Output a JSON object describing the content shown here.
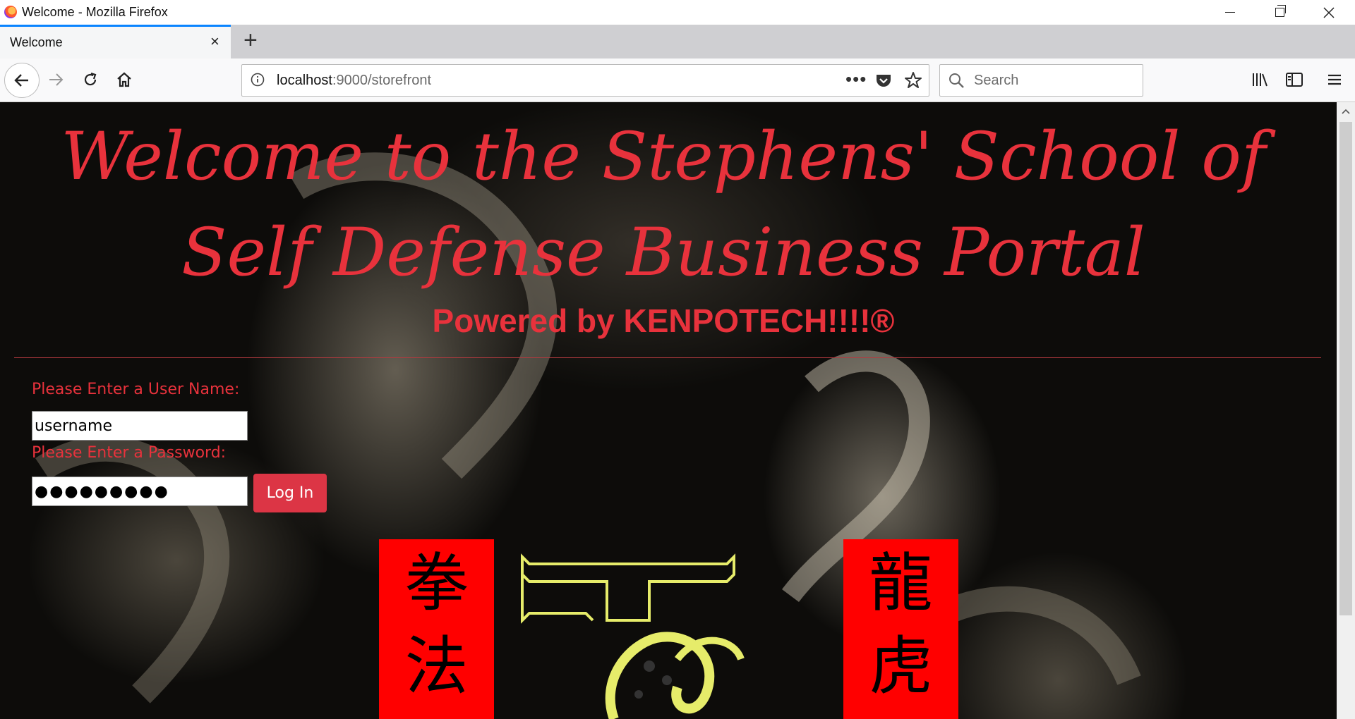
{
  "window": {
    "title": "Welcome - Mozilla Firefox"
  },
  "tabs": [
    {
      "label": "Welcome",
      "active": true
    }
  ],
  "navbar": {
    "url_host": "localhost",
    "url_rest": ":9000/storefront",
    "search_placeholder": "Search"
  },
  "page": {
    "heading": "Welcome to the Stephens' School of Self Defense Business Portal",
    "powered_by": "Powered by KENPOTECH!!!!®",
    "login": {
      "username_label": "Please Enter a User Name:",
      "username_value": "username",
      "password_label": "Please Enter a Password:",
      "password_value": "●●●●●●●●●",
      "button_label": "Log In"
    },
    "banner_left": "拳法",
    "banner_right": "龍虎"
  },
  "colors": {
    "accent_red": "#e8323c",
    "button_red": "#dc3545",
    "banner_red": "#ff0000",
    "logo_yellow": "#e6ec6a"
  }
}
